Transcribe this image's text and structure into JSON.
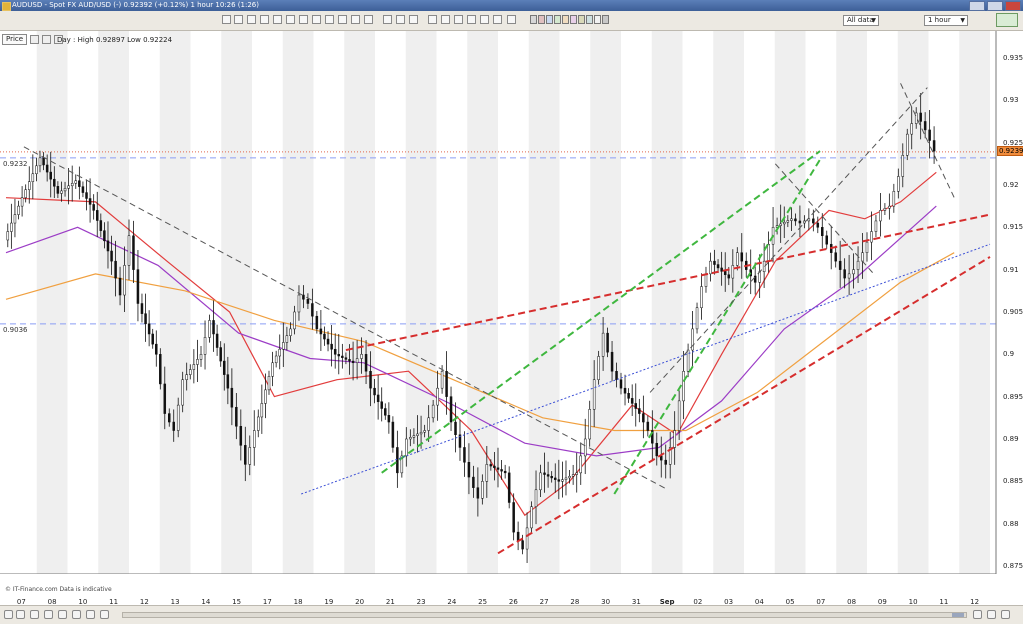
{
  "window": {
    "title": "AUDUSD - Spot FX AUD/USD (-)    0.92392 (+0.12%)    1 hour    10:26 (1:26)"
  },
  "toolbar": {
    "range_dropdown": "All data",
    "interval_dropdown": "1 hour",
    "swatch_colors": [
      "#d7d7d7",
      "#e0c0c0",
      "#c9d8ef",
      "#d4e8cf",
      "#f0dcc0",
      "#e8d0e8",
      "#d9d9b9",
      "#cfe0e0",
      "#f2f2f2",
      "#c8c8c8"
    ]
  },
  "chart_header": {
    "price_label": "Price",
    "day_info": "Day : High 0.92897 Low 0.92224"
  },
  "horizontal_levels": {
    "upper_label": "0.9232",
    "lower_label": "0.9036"
  },
  "current_price": "0.92392",
  "credit": "© IT-Finance.com  Data is indicative",
  "chart_data": {
    "type": "line",
    "instrument": "AUDUSD",
    "interval": "1 hour",
    "y_axis": {
      "ticks": [
        "0.935",
        "0.93",
        "0.925",
        "0.92",
        "0.915",
        "0.91",
        "0.905",
        "0.9",
        "0.895",
        "0.89",
        "0.885",
        "0.88",
        "0.875"
      ],
      "ylim": [
        0.875,
        0.937
      ]
    },
    "x_axis": {
      "ticks": [
        "07",
        "08",
        "10",
        "11",
        "12",
        "13",
        "14",
        "15",
        "17",
        "18",
        "19",
        "20",
        "21",
        "23",
        "24",
        "25",
        "26",
        "27",
        "28",
        "30",
        "31",
        "Sep",
        "02",
        "03",
        "04",
        "05",
        "07",
        "08",
        "09",
        "10",
        "11",
        "12"
      ]
    },
    "x_count": 110,
    "price_series": [
      {
        "x": 0,
        "y": 0.9135
      },
      {
        "x": 2,
        "y": 0.9185
      },
      {
        "x": 4,
        "y": 0.9232
      },
      {
        "x": 6,
        "y": 0.919
      },
      {
        "x": 8,
        "y": 0.9205
      },
      {
        "x": 10,
        "y": 0.917
      },
      {
        "x": 12,
        "y": 0.911
      },
      {
        "x": 13,
        "y": 0.907
      },
      {
        "x": 14,
        "y": 0.914
      },
      {
        "x": 15,
        "y": 0.906
      },
      {
        "x": 17,
        "y": 0.9
      },
      {
        "x": 18,
        "y": 0.893
      },
      {
        "x": 19,
        "y": 0.891
      },
      {
        "x": 20,
        "y": 0.897
      },
      {
        "x": 22,
        "y": 0.9
      },
      {
        "x": 23,
        "y": 0.904
      },
      {
        "x": 25,
        "y": 0.896
      },
      {
        "x": 26,
        "y": 0.8915
      },
      {
        "x": 27,
        "y": 0.887
      },
      {
        "x": 28,
        "y": 0.891
      },
      {
        "x": 30,
        "y": 0.899
      },
      {
        "x": 32,
        "y": 0.903
      },
      {
        "x": 33,
        "y": 0.907
      },
      {
        "x": 34,
        "y": 0.906
      },
      {
        "x": 35,
        "y": 0.903
      },
      {
        "x": 37,
        "y": 0.9
      },
      {
        "x": 39,
        "y": 0.899
      },
      {
        "x": 40,
        "y": 0.9
      },
      {
        "x": 41,
        "y": 0.896
      },
      {
        "x": 43,
        "y": 0.892
      },
      {
        "x": 44,
        "y": 0.886
      },
      {
        "x": 45,
        "y": 0.89
      },
      {
        "x": 47,
        "y": 0.891
      },
      {
        "x": 48,
        "y": 0.894
      },
      {
        "x": 49,
        "y": 0.898
      },
      {
        "x": 50,
        "y": 0.892
      },
      {
        "x": 51,
        "y": 0.889
      },
      {
        "x": 52,
        "y": 0.8855
      },
      {
        "x": 53,
        "y": 0.883
      },
      {
        "x": 54,
        "y": 0.887
      },
      {
        "x": 56,
        "y": 0.886
      },
      {
        "x": 57,
        "y": 0.879
      },
      {
        "x": 58,
        "y": 0.877
      },
      {
        "x": 59,
        "y": 0.882
      },
      {
        "x": 60,
        "y": 0.886
      },
      {
        "x": 62,
        "y": 0.885
      },
      {
        "x": 64,
        "y": 0.886
      },
      {
        "x": 65,
        "y": 0.89
      },
      {
        "x": 66,
        "y": 0.897
      },
      {
        "x": 67,
        "y": 0.9025
      },
      {
        "x": 68,
        "y": 0.898
      },
      {
        "x": 69,
        "y": 0.896
      },
      {
        "x": 71,
        "y": 0.893
      },
      {
        "x": 72,
        "y": 0.891
      },
      {
        "x": 73,
        "y": 0.888
      },
      {
        "x": 74,
        "y": 0.887
      },
      {
        "x": 75,
        "y": 0.891
      },
      {
        "x": 76,
        "y": 0.898
      },
      {
        "x": 77,
        "y": 0.903
      },
      {
        "x": 78,
        "y": 0.908
      },
      {
        "x": 79,
        "y": 0.911
      },
      {
        "x": 81,
        "y": 0.909
      },
      {
        "x": 82,
        "y": 0.912
      },
      {
        "x": 83,
        "y": 0.91
      },
      {
        "x": 84,
        "y": 0.9085
      },
      {
        "x": 85,
        "y": 0.911
      },
      {
        "x": 86,
        "y": 0.915
      },
      {
        "x": 88,
        "y": 0.916
      },
      {
        "x": 89,
        "y": 0.9155
      },
      {
        "x": 90,
        "y": 0.916
      },
      {
        "x": 91,
        "y": 0.915
      },
      {
        "x": 92,
        "y": 0.913
      },
      {
        "x": 93,
        "y": 0.911
      },
      {
        "x": 94,
        "y": 0.909
      },
      {
        "x": 95,
        "y": 0.91
      },
      {
        "x": 96,
        "y": 0.912
      },
      {
        "x": 97,
        "y": 0.9145
      },
      {
        "x": 98,
        "y": 0.917
      },
      {
        "x": 99,
        "y": 0.9175
      },
      {
        "x": 100,
        "y": 0.921
      },
      {
        "x": 101,
        "y": 0.926
      },
      {
        "x": 102,
        "y": 0.9285
      },
      {
        "x": 103,
        "y": 0.9265
      },
      {
        "x": 104,
        "y": 0.924
      }
    ],
    "moving_averages": [
      {
        "name": "MA red",
        "color": "#e23c3c",
        "values": [
          {
            "x": 0,
            "y": 0.9185
          },
          {
            "x": 10,
            "y": 0.918
          },
          {
            "x": 18,
            "y": 0.911
          },
          {
            "x": 25,
            "y": 0.905
          },
          {
            "x": 30,
            "y": 0.895
          },
          {
            "x": 37,
            "y": 0.897
          },
          {
            "x": 45,
            "y": 0.898
          },
          {
            "x": 52,
            "y": 0.891
          },
          {
            "x": 58,
            "y": 0.881
          },
          {
            "x": 63,
            "y": 0.885
          },
          {
            "x": 70,
            "y": 0.894
          },
          {
            "x": 75,
            "y": 0.8905
          },
          {
            "x": 80,
            "y": 0.9
          },
          {
            "x": 86,
            "y": 0.911
          },
          {
            "x": 92,
            "y": 0.917
          },
          {
            "x": 96,
            "y": 0.916
          },
          {
            "x": 100,
            "y": 0.918
          },
          {
            "x": 104,
            "y": 0.9215
          }
        ]
      },
      {
        "name": "MA purple",
        "color": "#9c3dc6",
        "values": [
          {
            "x": 0,
            "y": 0.912
          },
          {
            "x": 8,
            "y": 0.915
          },
          {
            "x": 17,
            "y": 0.9105
          },
          {
            "x": 26,
            "y": 0.9025
          },
          {
            "x": 34,
            "y": 0.8995
          },
          {
            "x": 40,
            "y": 0.899
          },
          {
            "x": 50,
            "y": 0.894
          },
          {
            "x": 58,
            "y": 0.8895
          },
          {
            "x": 66,
            "y": 0.888
          },
          {
            "x": 73,
            "y": 0.889
          },
          {
            "x": 80,
            "y": 0.8945
          },
          {
            "x": 87,
            "y": 0.903
          },
          {
            "x": 95,
            "y": 0.909
          },
          {
            "x": 104,
            "y": 0.9175
          }
        ]
      },
      {
        "name": "MA orange",
        "color": "#f0a040",
        "values": [
          {
            "x": 0,
            "y": 0.9065
          },
          {
            "x": 10,
            "y": 0.9095
          },
          {
            "x": 20,
            "y": 0.9075
          },
          {
            "x": 30,
            "y": 0.904
          },
          {
            "x": 40,
            "y": 0.9015
          },
          {
            "x": 50,
            "y": 0.897
          },
          {
            "x": 60,
            "y": 0.8925
          },
          {
            "x": 68,
            "y": 0.891
          },
          {
            "x": 76,
            "y": 0.891
          },
          {
            "x": 84,
            "y": 0.8955
          },
          {
            "x": 92,
            "y": 0.902
          },
          {
            "x": 100,
            "y": 0.9085
          },
          {
            "x": 106,
            "y": 0.912
          }
        ]
      }
    ],
    "trend_lines": [
      {
        "style": "dashed",
        "color": "#555555",
        "from": {
          "x": 2,
          "y": 0.9245
        },
        "to": {
          "x": 74,
          "y": 0.884
        }
      },
      {
        "style": "dashed",
        "color": "#d62d2d",
        "from": {
          "x": 38,
          "y": 0.9005
        },
        "to": {
          "x": 110,
          "y": 0.9165
        }
      },
      {
        "style": "dashed",
        "color": "#d62d2d",
        "from": {
          "x": 55,
          "y": 0.8765
        },
        "to": {
          "x": 110,
          "y": 0.9115
        }
      },
      {
        "style": "dashed",
        "color": "#3fb73f",
        "from": {
          "x": 42,
          "y": 0.886
        },
        "to": {
          "x": 91,
          "y": 0.924
        }
      },
      {
        "style": "dashed",
        "color": "#3fb73f",
        "from": {
          "x": 68,
          "y": 0.8835
        },
        "to": {
          "x": 91,
          "y": 0.923
        }
      },
      {
        "style": "dotted",
        "color": "#3b4fd6",
        "from": {
          "x": 33,
          "y": 0.8835
        },
        "to": {
          "x": 110,
          "y": 0.913
        }
      },
      {
        "style": "dashed",
        "color": "#555555",
        "from": {
          "x": 72,
          "y": 0.8955
        },
        "to": {
          "x": 103,
          "y": 0.9315
        }
      },
      {
        "style": "dashed",
        "color": "#555555",
        "from": {
          "x": 86,
          "y": 0.9225
        },
        "to": {
          "x": 97,
          "y": 0.9095
        }
      },
      {
        "style": "dashed",
        "color": "#555555",
        "from": {
          "x": 100,
          "y": 0.932
        },
        "to": {
          "x": 106,
          "y": 0.9185
        }
      }
    ],
    "horizontal_lines": [
      {
        "y": 0.9232,
        "color": "#8a9ef5",
        "style": "dashed"
      },
      {
        "y": 0.9036,
        "color": "#8a9ef5",
        "style": "dashed"
      },
      {
        "y": 0.9239,
        "color": "#e0664a",
        "style": "dotted"
      }
    ],
    "grid": "alternating vertical day bands"
  }
}
